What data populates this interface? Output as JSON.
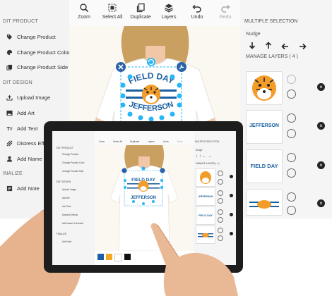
{
  "left_panel": {
    "edit_product_header": "DIT PRODUCT",
    "product_items": [
      {
        "label": "Change Product",
        "icon": "tag-icon"
      },
      {
        "label": "Change Product Color",
        "icon": "palette-icon"
      },
      {
        "label": "Change Product Side",
        "icon": "copy-icon"
      }
    ],
    "edit_design_header": "DIT DESIGN",
    "design_items": [
      {
        "label": "Upload Image",
        "icon": "upload-icon"
      },
      {
        "label": "Add Art",
        "icon": "image-icon"
      },
      {
        "label": "Add Text",
        "icon": "text-icon"
      },
      {
        "label": "Distress Effe",
        "icon": "distress-icon"
      },
      {
        "label": "Add Name &",
        "icon": "user-icon"
      }
    ],
    "finalize_header": "INALIZE",
    "finalize_items": [
      {
        "label": "Add Note",
        "icon": "note-icon"
      }
    ]
  },
  "toolbar": {
    "buttons": [
      {
        "label": "Zoom",
        "icon": "zoom-icon"
      },
      {
        "label": "Select All",
        "icon": "select-all-icon"
      },
      {
        "label": "Duplicate",
        "icon": "duplicate-icon"
      },
      {
        "label": "Layers",
        "icon": "layers-icon"
      },
      {
        "label": "Undo",
        "icon": "undo-icon"
      },
      {
        "label": "Redo",
        "icon": "redo-icon"
      }
    ]
  },
  "canvas": {
    "design_text_top": "FIELD DAY",
    "design_text_bottom": "JEFFERSON",
    "accent_color": "#1a5fa0",
    "handle_color": "#29b6f6"
  },
  "right_panel": {
    "title": "MULTIPLE SELECTION",
    "nudge_label": "Nudge",
    "manage_layers_label": "MANAGE LAYERS ( 4 )",
    "layers": [
      {
        "name": "tiger-mascot",
        "text": ""
      },
      {
        "name": "jefferson-text",
        "text": "JEFFERSON"
      },
      {
        "name": "field-day-text",
        "text": "FIELD DAY"
      },
      {
        "name": "stripe-graphic",
        "text": ""
      }
    ]
  },
  "tablet": {
    "left_items": [
      "EDIT PRODUCT",
      "Change Product",
      "Change Product Color",
      "Change Product Side",
      "EDIT DESIGN",
      "Upload Image",
      "Add Art",
      "Add Text",
      "Distress Effects",
      "Add Name & Number",
      "FINALIZE",
      "Add Note"
    ],
    "toolbar_labels": [
      "Zoom",
      "Select All",
      "Duplicate",
      "Layers",
      "Undo",
      "Redo"
    ],
    "right_title": "MULTIPLE SELECTION",
    "nudge_label": "Nudge",
    "layers_label": "MANAGE LAYERS ( 4 )",
    "swatch_colors": [
      "#1a5fa0",
      "#f5a623",
      "#ffffff",
      "#111111"
    ]
  }
}
